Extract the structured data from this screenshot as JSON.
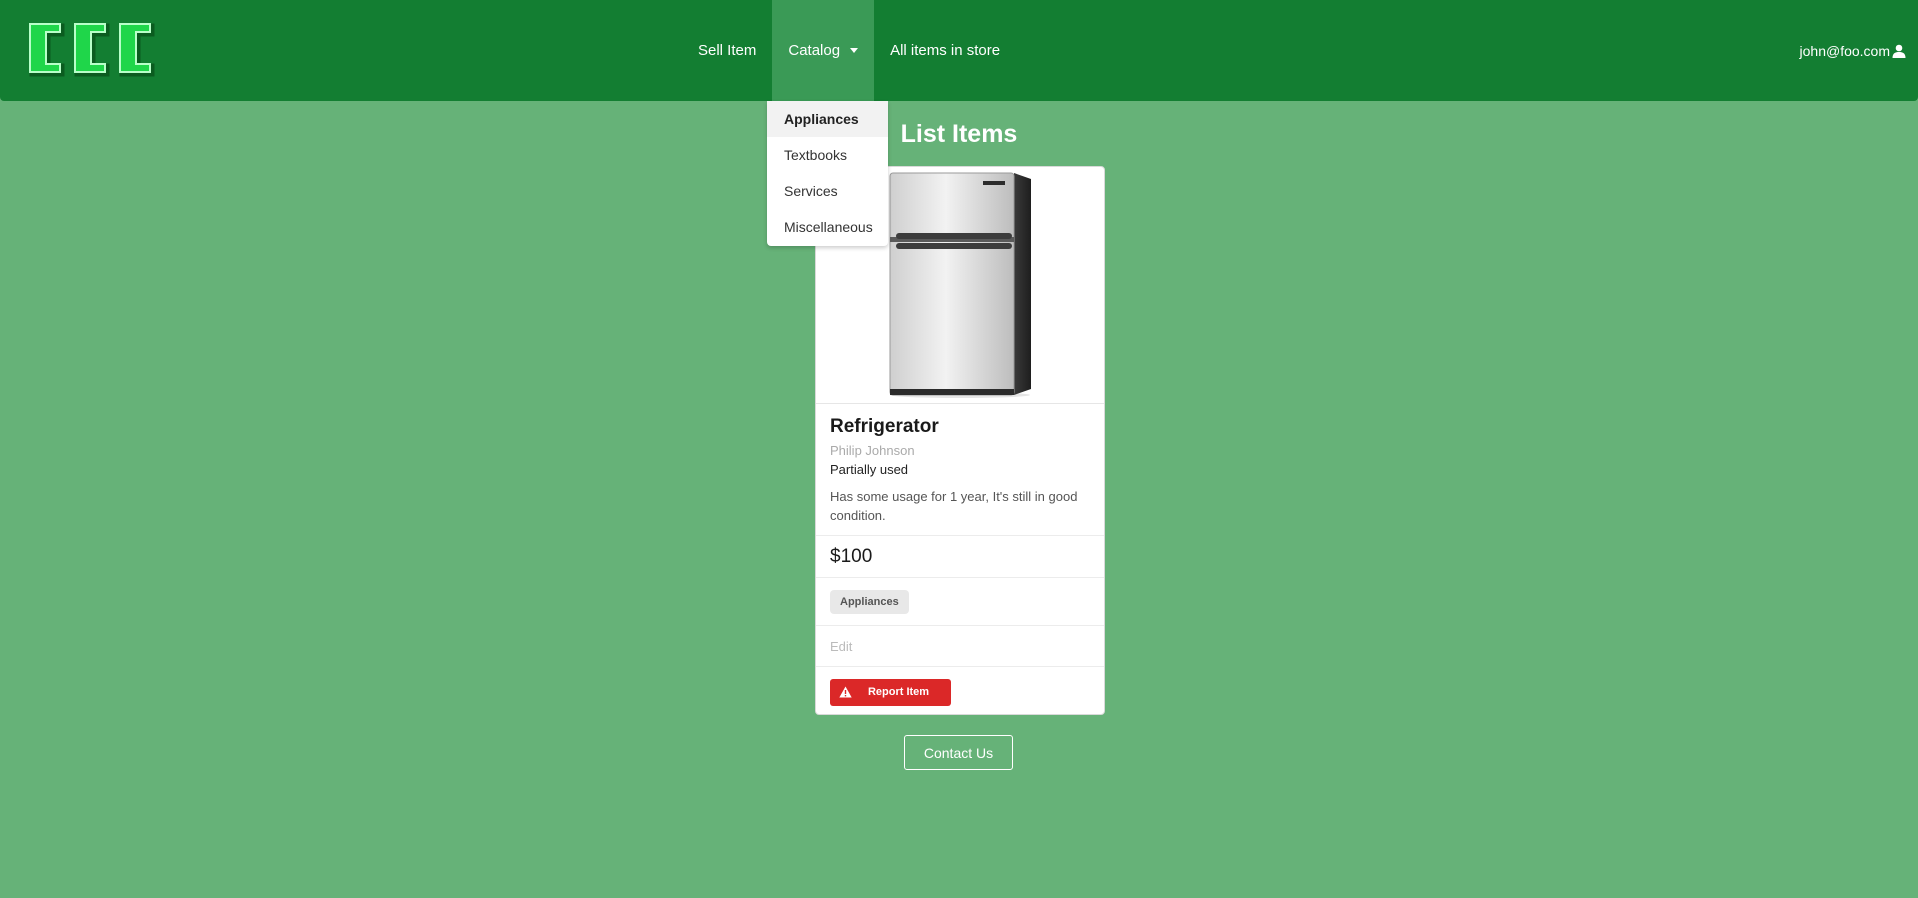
{
  "navbar": {
    "logo_text": "CCC",
    "links": [
      {
        "label": "Sell Item"
      },
      {
        "label": "Catalog"
      },
      {
        "label": "All items in store"
      }
    ],
    "user_email": "john@foo.com",
    "user_icon": "user-icon",
    "colors": {
      "navbar": "#137e32",
      "active": "#3a9a56",
      "background": "#66b278",
      "logo": "#1fd64a"
    }
  },
  "dropdown": {
    "items": [
      "Appliances",
      "Textbooks",
      "Services",
      "Miscellaneous"
    ],
    "selected": "Appliances"
  },
  "page": {
    "title": "List Items"
  },
  "item": {
    "name": "Refrigerator",
    "seller": "Philip Johnson",
    "condition": "Partially used",
    "description": "Has some usage for 1 year, It's still in good condition.",
    "price": "$100",
    "category": "Appliances",
    "edit_label": "Edit",
    "report_label": "Report Item",
    "report_icon": "warning-icon",
    "report_color": "#db2828"
  },
  "footer": {
    "contact_label": "Contact Us"
  }
}
